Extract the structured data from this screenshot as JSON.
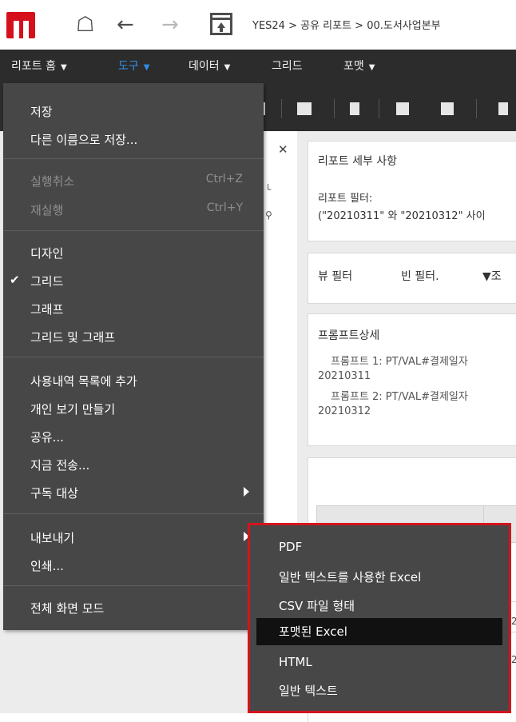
{
  "topbar": {
    "breadcrumb": "YES24 > 공유 리포트 > 00.도서사업본부"
  },
  "menubar": {
    "items": [
      {
        "label": "리포트 홈",
        "has_caret": true
      },
      {
        "label": "도구",
        "has_caret": true,
        "active": true
      },
      {
        "label": "데이터",
        "has_caret": true
      },
      {
        "label": "그리드",
        "has_caret": false
      },
      {
        "label": "포맷",
        "has_caret": true
      }
    ],
    "active_color": "#2f8fe6"
  },
  "panels": {
    "details": {
      "title": "리포트 세부 사항",
      "filter_label": "리포트 필터:",
      "filter_value": "(\"20210311\" 와 \"20210312\" 사이"
    },
    "filters": {
      "view_filter": "뷰 필터",
      "empty_filter": "빈 필터.",
      "condition": "조"
    },
    "prompt": {
      "title": "프롬프트상세",
      "lines": [
        "프롬프트 1: PT/VAL#결제일자",
        "20210311",
        "프롬프트 2: PT/VAL#결제일자",
        "20210312"
      ]
    },
    "grid_numbers": [
      "2",
      "2"
    ]
  },
  "dropdown": {
    "save": "저장",
    "save_as": "다른 이름으로 저장...",
    "undo": "실행취소",
    "undo_shortcut": "Ctrl+Z",
    "redo": "재실행",
    "redo_shortcut": "Ctrl+Y",
    "design": "디자인",
    "grid": "그리드",
    "graph": "그래프",
    "grid_and_graph": "그리드 및 그래프",
    "add_history": "사용내역 목록에 추가",
    "create_personal_view": "개인 보기 만들기",
    "share": "공유...",
    "send_now": "지금 전송...",
    "subscribe": "구독 대상",
    "export": "내보내기",
    "print": "인쇄...",
    "fullscreen": "전체 화면 모드",
    "check_mark": "✔"
  },
  "export_submenu": {
    "items": [
      "PDF",
      "일반 텍스트를 사용한 Excel",
      "CSV 파일 형태",
      "포맷된 Excel",
      "HTML",
      "일반 텍스트"
    ],
    "highlighted": "포맷된 Excel",
    "border_color": "#d4141e"
  },
  "colors": {
    "brand": "#d5101c",
    "menu_bg": "#474747",
    "menubar_bg": "#2c2c2c"
  }
}
